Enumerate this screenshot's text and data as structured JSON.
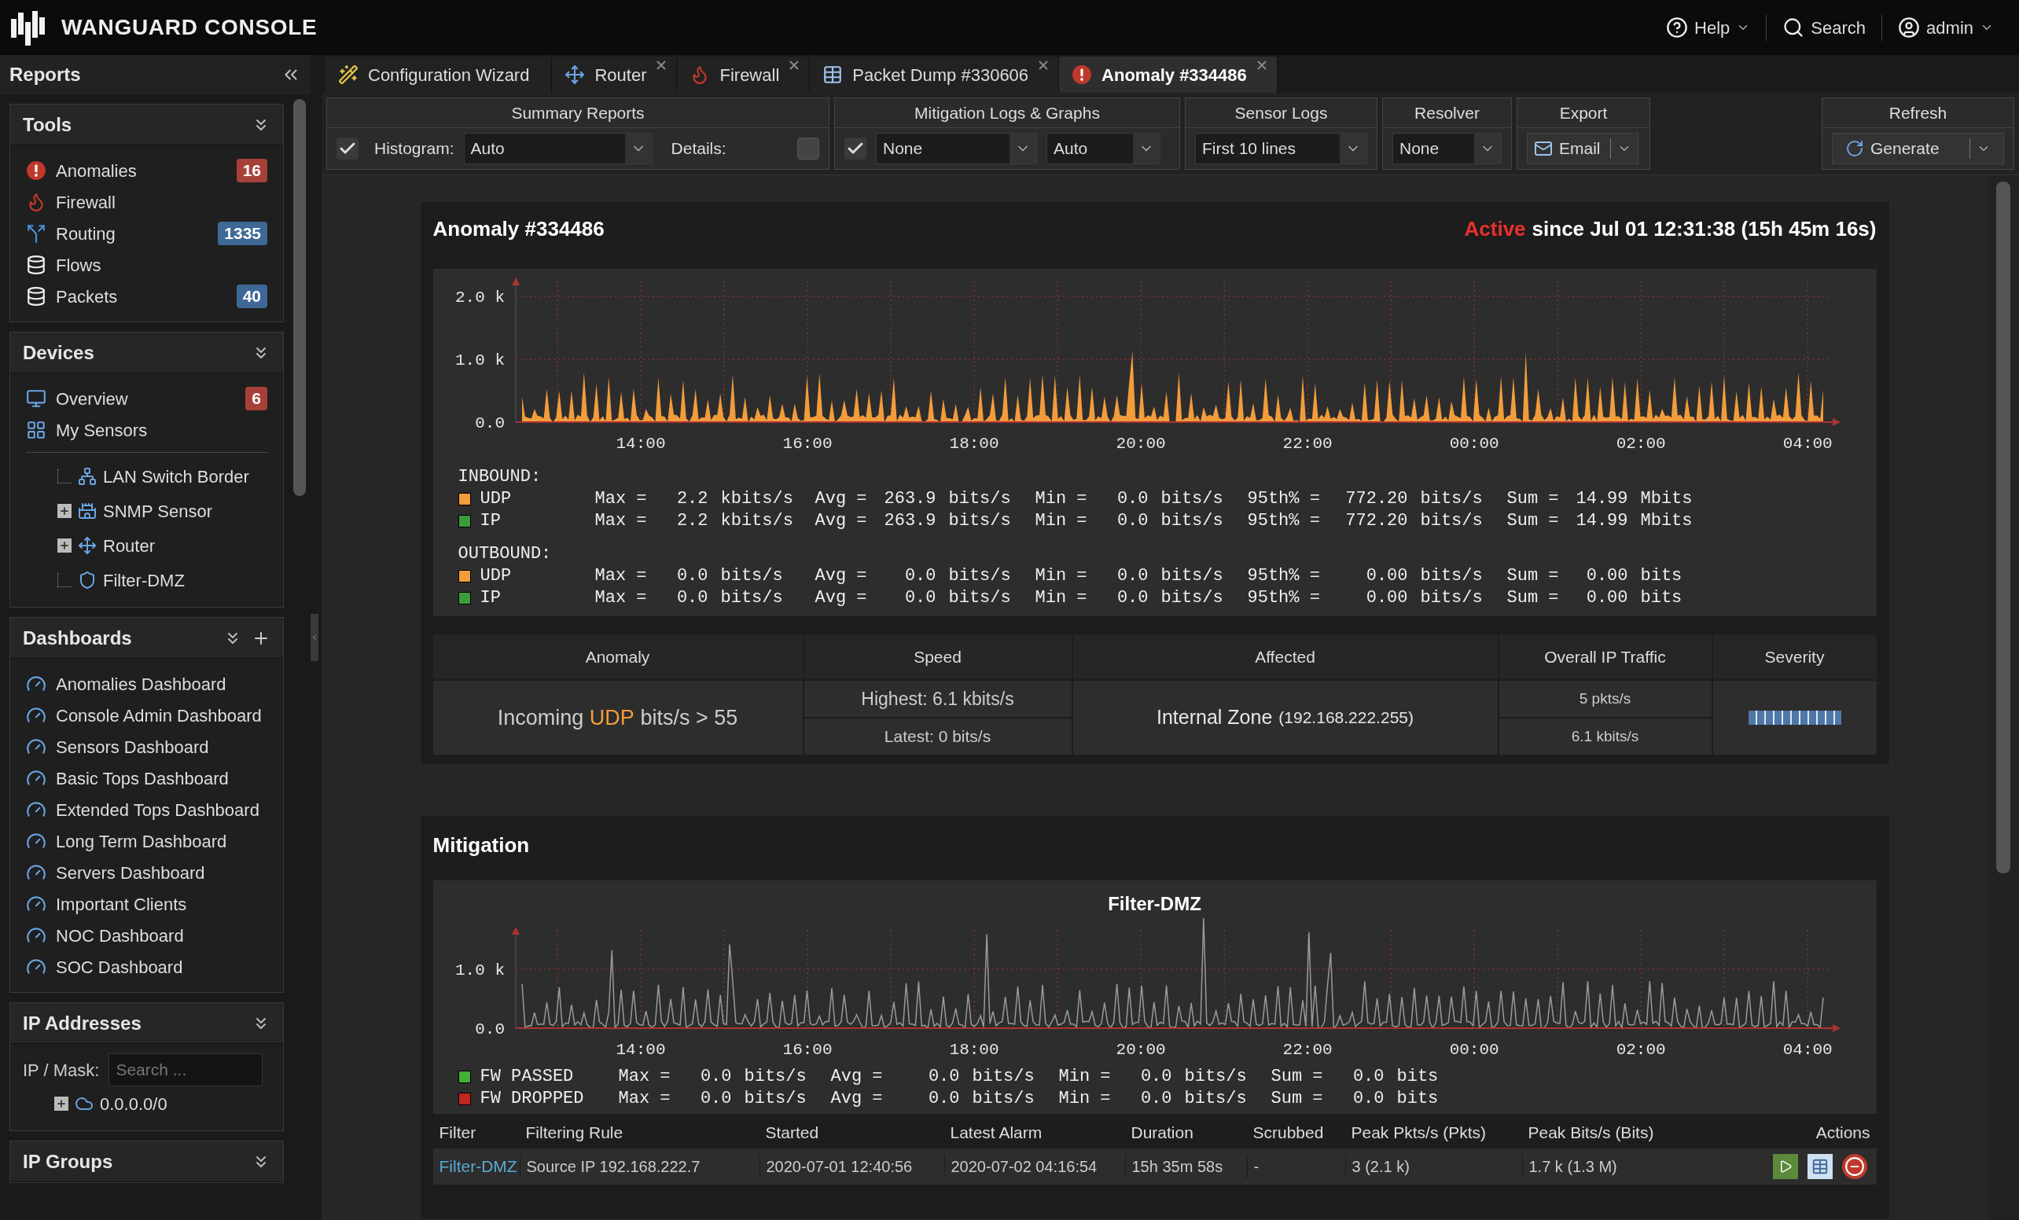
{
  "header": {
    "title": "WANGUARD CONSOLE",
    "menus": [
      {
        "label": "Help",
        "caret": true
      },
      {
        "label": "Search",
        "caret": false
      },
      {
        "label": "admin",
        "caret": true
      }
    ]
  },
  "sidebar": {
    "title": "Reports",
    "tools": {
      "title": "Tools",
      "items": [
        {
          "label": "Anomalies",
          "badge": "16",
          "color": "#a8403a"
        },
        {
          "label": "Firewall"
        },
        {
          "label": "Routing",
          "badge": "1335",
          "color": "#3e6896"
        },
        {
          "label": "Flows"
        },
        {
          "label": "Packets",
          "badge": "40",
          "color": "#3e6896"
        }
      ]
    },
    "devices": {
      "title": "Devices",
      "items": [
        {
          "label": "Overview",
          "badge": "6",
          "color": "#a8403a"
        },
        {
          "label": "My Sensors"
        }
      ],
      "tree": [
        {
          "label": "LAN Switch Border",
          "kind": "leaf"
        },
        {
          "label": "SNMP Sensor",
          "kind": "group",
          "expanded": false
        },
        {
          "label": "Router",
          "kind": "group",
          "expanded": false
        },
        {
          "label": "Filter-DMZ",
          "kind": "leaf"
        }
      ]
    },
    "dashboards": {
      "title": "Dashboards",
      "items": [
        "Anomalies Dashboard",
        "Console Admin Dashboard",
        "Sensors Dashboard",
        "Basic Tops Dashboard",
        "Extended Tops Dashboard",
        "Long Term Dashboard",
        "Servers Dashboard",
        "Important Clients",
        "NOC Dashboard",
        "SOC Dashboard"
      ]
    },
    "ip_addresses": {
      "title": "IP Addresses",
      "field_label": "IP / Mask:",
      "placeholder": "Search ...",
      "tree": [
        {
          "label": "0.0.0.0/0",
          "kind": "group",
          "expanded": false
        }
      ]
    },
    "ip_groups": {
      "title": "IP Groups"
    }
  },
  "tabs": [
    {
      "label": "Configuration Wizard",
      "closable": false,
      "selected": false
    },
    {
      "label": "Router",
      "closable": true,
      "selected": false
    },
    {
      "label": "Firewall",
      "closable": true,
      "selected": false
    },
    {
      "label": "Packet Dump #330606",
      "closable": true,
      "selected": false
    },
    {
      "label": "Anomaly #334486",
      "closable": true,
      "selected": true
    }
  ],
  "toolbar": {
    "summary": {
      "title": "Summary Reports",
      "checked": true,
      "histogram_label": "Histogram:",
      "histogram": "Auto",
      "details_label": "Details:",
      "details": false
    },
    "mitigation": {
      "title": "Mitigation Logs & Graphs",
      "checked": true,
      "select_1": "None",
      "select_2": "Auto"
    },
    "sensor_logs": {
      "title": "Sensor Logs",
      "value": "First 10 lines"
    },
    "resolver": {
      "title": "Resolver",
      "value": "None"
    },
    "export": {
      "title": "Export",
      "button": "Email"
    },
    "refresh": {
      "title": "Refresh",
      "button": "Generate"
    }
  },
  "anomaly": {
    "title": "Anomaly #334486",
    "status": "Active",
    "since": "since Jul 01 12:31:38 (15h 45m 16s)",
    "graph": {
      "yticks": [
        "2.0 k",
        "1.0 k",
        "0.0"
      ],
      "xticks": [
        "14:00",
        "16:00",
        "18:00",
        "20:00",
        "22:00",
        "00:00",
        "02:00",
        "04:00"
      ]
    },
    "legend": [
      {
        "heading": "INBOUND:",
        "rows": [
          {
            "name": "UDP",
            "color": "#f39c3c",
            "cells": [
              "Max =",
              "2.2",
              "kbits/s",
              "Avg =",
              "263.9",
              "bits/s",
              "Min =",
              "0.0",
              "bits/s",
              "95th% =",
              "772.20",
              "bits/s",
              "Sum =",
              "14.99",
              "Mbits"
            ]
          },
          {
            "name": "IP",
            "color": "#3c9c3c",
            "cells": [
              "Max =",
              "2.2",
              "kbits/s",
              "Avg =",
              "263.9",
              "bits/s",
              "Min =",
              "0.0",
              "bits/s",
              "95th% =",
              "772.20",
              "bits/s",
              "Sum =",
              "14.99",
              "Mbits"
            ]
          }
        ]
      },
      {
        "heading": "OUTBOUND:",
        "rows": [
          {
            "name": "UDP",
            "color": "#f39c3c",
            "cells": [
              "Max =",
              "0.0",
              "bits/s",
              "Avg =",
              "0.0",
              "bits/s",
              "Min =",
              "0.0",
              "bits/s",
              "95th% =",
              "0.00",
              "bits/s",
              "Sum =",
              "0.00",
              "bits"
            ]
          },
          {
            "name": "IP",
            "color": "#3c9c3c",
            "cells": [
              "Max =",
              "0.0",
              "bits/s",
              "Avg =",
              "0.0",
              "bits/s",
              "Min =",
              "0.0",
              "bits/s",
              "95th% =",
              "0.00",
              "bits/s",
              "Sum =",
              "0.00",
              "bits"
            ]
          }
        ]
      }
    ],
    "summary": {
      "columns": [
        "Anomaly",
        "Speed",
        "Affected",
        "Overall IP Traffic",
        "Severity"
      ],
      "anomaly": {
        "prefix": "Incoming",
        "highlight": "UDP",
        "suffix": "bits/s > 55"
      },
      "speed": [
        "Highest: 6.1 kbits/s",
        "Latest: 0 bits/s"
      ],
      "affected": {
        "zone": "Internal Zone",
        "ip": "(192.168.222.255)"
      },
      "traffic": [
        "5 pkts/s",
        "6.1 kbits/s"
      ],
      "severity": {
        "level": 1
      }
    }
  },
  "mitigation": {
    "title": "Mitigation",
    "graph": {
      "title": "Filter-DMZ",
      "yticks": [
        "1.0 k",
        "0.0"
      ],
      "xticks": [
        "14:00",
        "16:00",
        "18:00",
        "20:00",
        "22:00",
        "00:00",
        "02:00",
        "04:00"
      ]
    },
    "legend": [
      {
        "name": "FW PASSED",
        "color": "#44b035",
        "cells": [
          "Max =",
          "0.0",
          "bits/s",
          "Avg =",
          "0.0",
          "bits/s",
          "Min =",
          "0.0",
          "bits/s",
          "Sum =",
          "0.0",
          "bits"
        ]
      },
      {
        "name": "FW DROPPED",
        "color": "#c0281e",
        "cells": [
          "Max =",
          "0.0",
          "bits/s",
          "Avg =",
          "0.0",
          "bits/s",
          "Min =",
          "0.0",
          "bits/s",
          "Sum =",
          "0.0",
          "bits"
        ]
      }
    ],
    "table": {
      "columns": [
        "Filter",
        "Filtering Rule",
        "Started",
        "Latest Alarm",
        "Duration",
        "Scrubbed",
        "Peak Pkts/s (Pkts)",
        "Peak Bits/s (Bits)",
        "Actions"
      ],
      "rows": [
        {
          "filter": "Filter-DMZ",
          "rule": "Source IP 192.168.222.7",
          "started": "2020-07-01 12:40:56",
          "latest": "2020-07-02 04:16:54",
          "duration": "15h 35m 58s",
          "scrubbed": "-",
          "peak_pkts": "3 (2.1 k)",
          "peak_bits": "1.7 k (1.3 M)"
        }
      ]
    }
  }
}
